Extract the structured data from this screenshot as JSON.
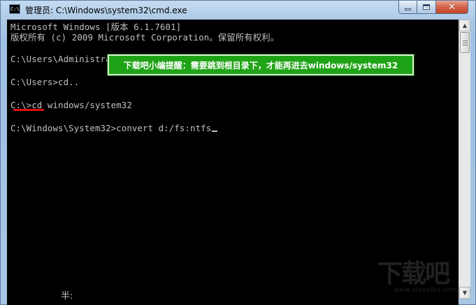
{
  "window": {
    "title": "管理员: C:\\Windows\\system32\\cmd.exe",
    "icon": "cmd-icon",
    "icon_text": "C:\\",
    "controls": {
      "minimize": "minimize-icon",
      "maximize": "maximize-icon",
      "close": "close-icon"
    }
  },
  "console": {
    "lines": [
      "Microsoft Windows [版本 6.1.7601]",
      "版权所有 (c) 2009 Microsoft Corporation。保留所有权利。",
      "",
      "C:\\Users\\Administrator>cd..",
      "",
      "C:\\Users>cd..",
      "",
      "C:\\>cd windows/system32",
      "",
      "C:\\Windows\\System32>convert d:/fs:ntfs"
    ],
    "ime_indicator": "半:"
  },
  "callout": {
    "text": "下载吧小编提醒：需要跳到根目录下，才能再进去windows/system32",
    "color": "#1fa316"
  },
  "watermark": {
    "logo": "下载吧",
    "url": "www.xiazaiba.com"
  },
  "colors": {
    "console_bg": "#000000",
    "console_text": "#c0c0c0",
    "underline": "#e01010",
    "close_button": "#c44523"
  }
}
